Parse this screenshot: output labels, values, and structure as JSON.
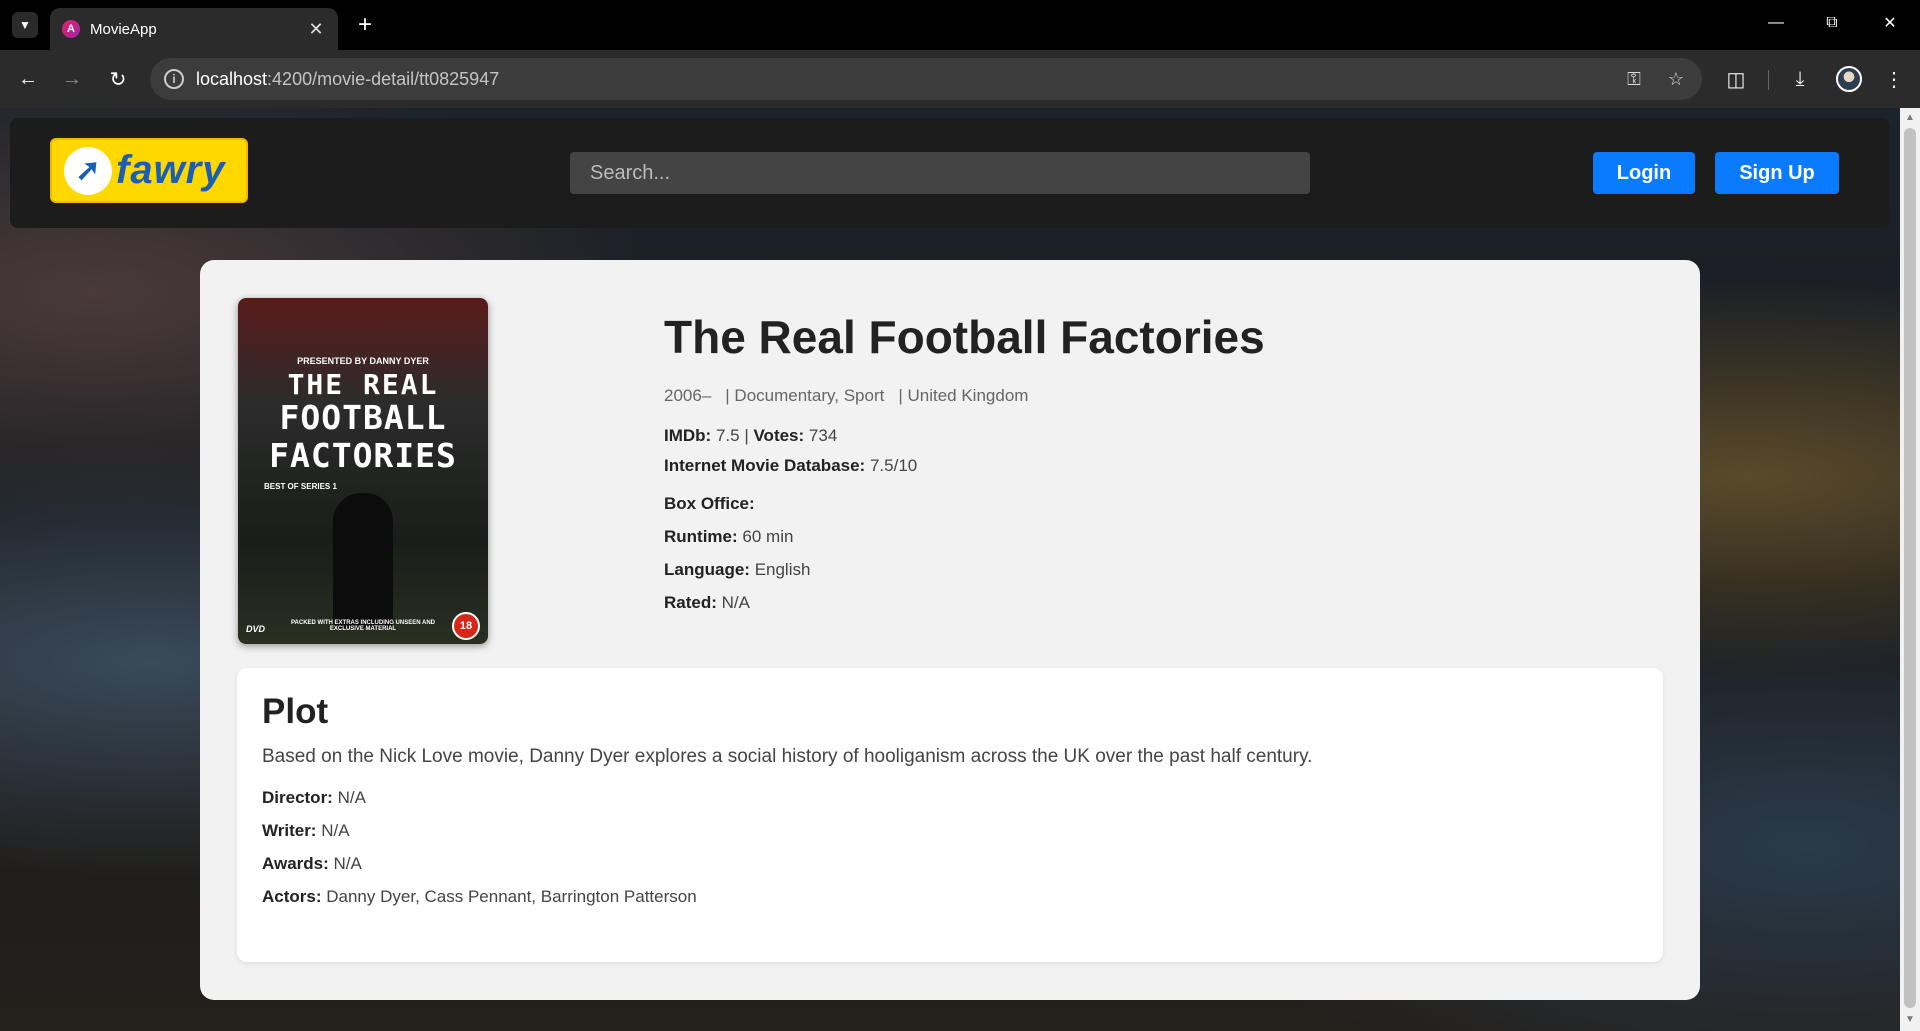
{
  "browser": {
    "tab_title": "MovieApp",
    "favicon_letter": "A",
    "url_host": "localhost",
    "url_path": ":4200/movie-detail/tt0825947"
  },
  "header": {
    "logo_text": "fawry",
    "search_placeholder": "Search...",
    "login_label": "Login",
    "signup_label": "Sign Up"
  },
  "movie": {
    "poster": {
      "presented_by": "PRESENTED BY DANNY DYER",
      "title_line1": "THE REAL",
      "title_line2": "FOOTBALL",
      "title_line3": "FACTORIES",
      "subtitle": "BEST OF SERIES 1",
      "bottom_text": "PACKED WITH EXTRAS INCLUDING UNSEEN AND EXCLUSIVE MATERIAL",
      "rating_badge": "18",
      "dvd_mark": "DVD"
    },
    "title": "The Real Football Factories",
    "year": "2006–",
    "genre": "| Documentary, Sport",
    "country": "| United Kingdom",
    "imdb_label": "IMDb:",
    "imdb_value": "7.5",
    "separator": "|",
    "votes_label": "Votes:",
    "votes_value": "734",
    "imdb_db_label": "Internet Movie Database:",
    "imdb_db_value": "7.5/10",
    "box_office_label": "Box Office:",
    "box_office_value": "",
    "runtime_label": "Runtime:",
    "runtime_value": "60 min",
    "language_label": "Language:",
    "language_value": "English",
    "rated_label": "Rated:",
    "rated_value": "N/A"
  },
  "plot": {
    "heading": "Plot",
    "text": "Based on the Nick Love movie, Danny Dyer explores a social history of hooliganism across the UK over the past half century.",
    "director_label": "Director:",
    "director_value": "N/A",
    "writer_label": "Writer:",
    "writer_value": "N/A",
    "awards_label": "Awards:",
    "awards_value": "N/A",
    "actors_label": "Actors:",
    "actors_value": "Danny Dyer, Cass Pennant, Barrington Patterson"
  },
  "colors": {
    "brand_yellow": "#ffd800",
    "button_blue": "#0a7bff",
    "header_bg": "#1c1c1c",
    "card_bg": "#f2f2f2"
  },
  "icons": [
    "tab-list-icon",
    "close-icon",
    "plus-icon",
    "minimize-icon",
    "restore-icon",
    "back-icon",
    "forward-icon",
    "reload-icon",
    "info-icon",
    "password-key-icon",
    "star-icon",
    "extensions-icon",
    "download-icon",
    "profile-avatar",
    "menu-icon"
  ]
}
